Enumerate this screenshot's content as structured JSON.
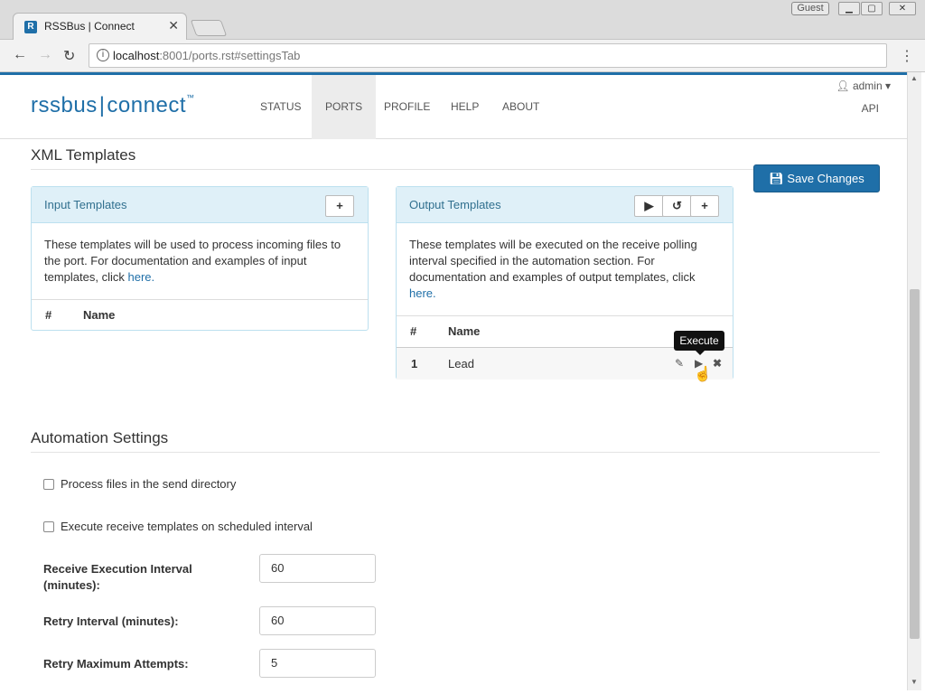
{
  "browser": {
    "tab_title": "RSSBus | Connect",
    "tab_close": "✕",
    "guest_label": "Guest",
    "url_host": "localhost",
    "url_rest": ":8001/ports.rst#settingsTab"
  },
  "header": {
    "logo_left": "rssbus",
    "logo_right": "connect",
    "logo_tm": "™",
    "nav": [
      "STATUS",
      "PORTS",
      "PROFILE",
      "HELP",
      "ABOUT"
    ],
    "active_nav": "PORTS",
    "user": "admin",
    "api": "API"
  },
  "xml_templates": {
    "title": "XML Templates",
    "save_label": "Save Changes",
    "input": {
      "title": "Input Templates",
      "desc_lines": [
        "These templates will be used to process incoming files to",
        "the port. For documentation and examples of input",
        "templates, click "
      ],
      "link": "here.",
      "col_num": "#",
      "col_name": "Name"
    },
    "output": {
      "title": "Output Templates",
      "desc_lines": [
        "These templates will be executed on the receive polling",
        "interval specified in the automation section. For",
        "documentation and examples of output templates, click"
      ],
      "link": "here.",
      "col_num": "#",
      "col_name": "Name",
      "rows": [
        {
          "num": "1",
          "name": "Lead"
        }
      ],
      "tooltip": "Execute"
    }
  },
  "automation": {
    "title": "Automation Settings",
    "checkboxes": [
      "Process files in the send directory",
      "Execute receive templates on scheduled interval"
    ],
    "fields": [
      {
        "label_lines": [
          "Receive Execution Interval",
          "(minutes):"
        ],
        "value": "60"
      },
      {
        "label_lines": [
          "Retry Interval (minutes):"
        ],
        "value": "60"
      },
      {
        "label_lines": [
          "Retry Maximum Attempts:"
        ],
        "value": "5"
      }
    ]
  }
}
